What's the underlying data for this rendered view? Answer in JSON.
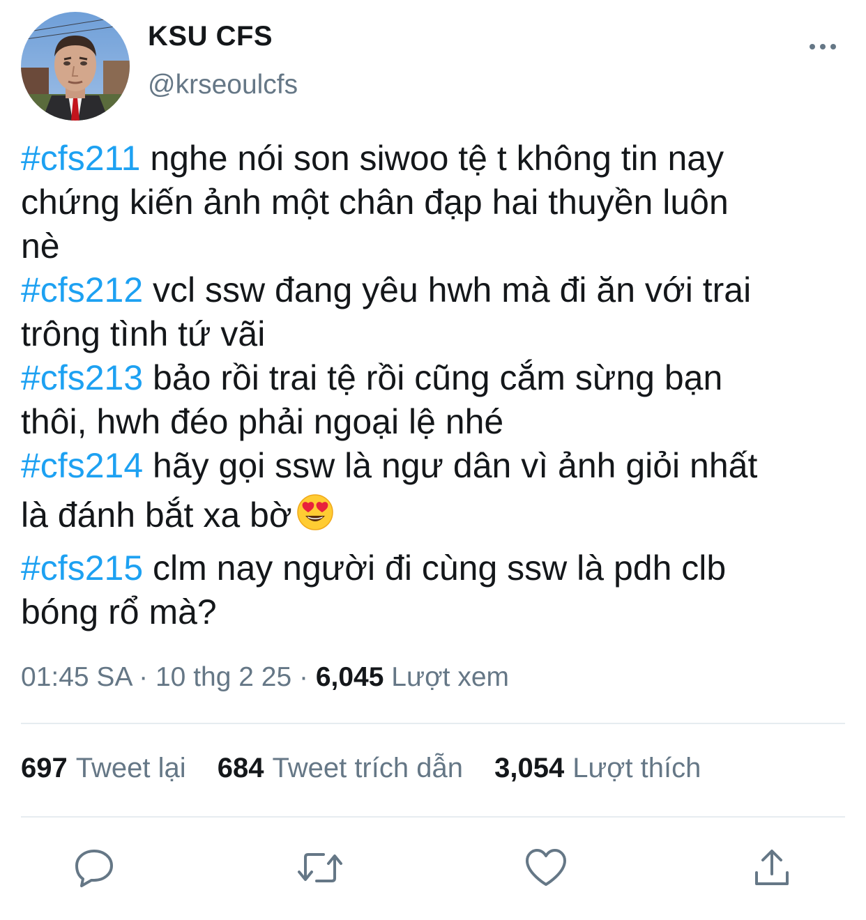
{
  "author": {
    "display_name": "KSU CFS",
    "handle": "@krseoulcfs"
  },
  "tweet": {
    "paragraphs": [
      {
        "hashtag": "#cfs211",
        "lines": [
          " nghe nói son siwoo tệ t không tin nay",
          "chứng kiến ảnh một chân đạp hai thuyền luôn",
          "nè"
        ]
      },
      {
        "hashtag": "#cfs212",
        "lines": [
          " vcl ssw đang yêu hwh mà đi ăn với trai",
          "trông tình tứ vãi"
        ]
      },
      {
        "hashtag": "#cfs213",
        "lines": [
          " bảo rồi trai tệ rồi cũng cắm sừng bạn",
          "thôi, hwh đéo phải ngoại lệ nhé"
        ]
      },
      {
        "hashtag": "#cfs214",
        "lines": [
          " hãy gọi ssw là ngư dân vì ảnh giỏi nhất",
          "là đánh bắt xa bờ"
        ]
      },
      {
        "hashtag": "#cfs215",
        "lines": [
          " clm nay người đi cùng ssw là pdh clb",
          "bóng rổ mà?"
        ]
      }
    ],
    "emoji": "smiling-face-with-heart-eyes"
  },
  "meta": {
    "time": "01:45 SA",
    "sep1": " · ",
    "date": "10 thg 2 25",
    "sep2": " · ",
    "views_count": "6,045",
    "views_label": " Lượt xem"
  },
  "stats": {
    "retweets": {
      "count": "697",
      "label": "Tweet lại"
    },
    "quotes": {
      "count": "684",
      "label": "Tweet trích dẫn"
    },
    "likes": {
      "count": "3,054",
      "label": "Lượt thích"
    }
  },
  "actions": [
    "reply-icon",
    "retweet-icon",
    "like-icon",
    "share-icon"
  ],
  "colors": {
    "hashtag": "#1da1f2",
    "secondary_text": "#657786",
    "primary_text": "#14171a",
    "divider": "#e6ecf0"
  }
}
